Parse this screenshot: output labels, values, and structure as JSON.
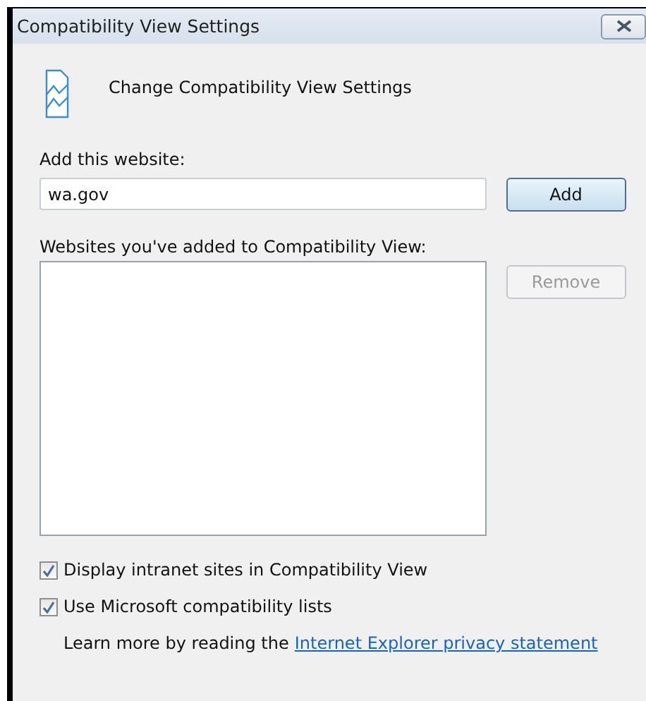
{
  "window": {
    "title": "Compatibility View Settings"
  },
  "heading": "Change Compatibility View Settings",
  "add_field": {
    "label": "Add this website:",
    "value": "wa.gov"
  },
  "add_button": {
    "label": "Add",
    "disabled": false
  },
  "list": {
    "label": "Websites you've added to Compatibility View:"
  },
  "remove_button": {
    "label": "Remove",
    "disabled": true
  },
  "options": [
    {
      "label": "Display intranet sites in Compatibility View",
      "checked": true
    },
    {
      "label": "Use Microsoft compatibility lists",
      "checked": true
    }
  ],
  "learn_more": {
    "text": "Learn more by reading the",
    "link": "Internet Explorer privacy statement"
  }
}
